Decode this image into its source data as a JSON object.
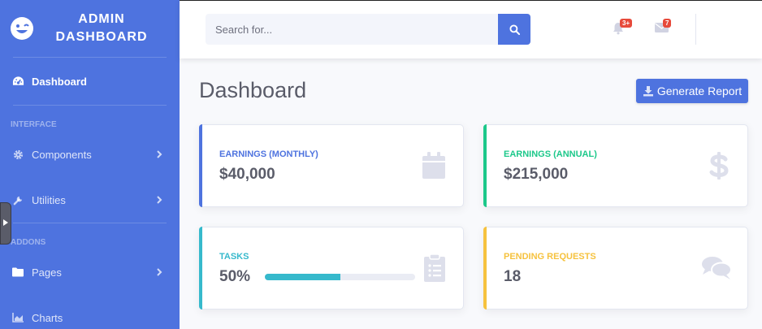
{
  "brand": {
    "title": "ADMIN\nDASHBOARD"
  },
  "sidebar": {
    "active_item": {
      "label": "Dashboard",
      "icon": "tachometer-icon"
    },
    "sections": [
      {
        "heading": "INTERFACE",
        "items": [
          {
            "label": "Components",
            "icon": "gear-icon"
          },
          {
            "label": "Utilities",
            "icon": "wrench-icon"
          }
        ]
      },
      {
        "heading": "ADDONS",
        "items": [
          {
            "label": "Pages",
            "icon": "folder-icon"
          },
          {
            "label": "Charts",
            "icon": "chart-area-icon"
          }
        ]
      }
    ]
  },
  "topbar": {
    "search_placeholder": "Search for...",
    "alerts_badge": "3+",
    "messages_badge": "7"
  },
  "page": {
    "title": "Dashboard",
    "generate_report_label": "Generate Report"
  },
  "cards": [
    {
      "label": "EARNINGS (MONTHLY)",
      "value": "$40,000",
      "color": "#4e73df",
      "icon": "calendar-icon"
    },
    {
      "label": "EARNINGS (ANNUAL)",
      "value": "$215,000",
      "color": "#1cc88a",
      "icon": "dollar-icon"
    },
    {
      "label": "TASKS",
      "value": "50%",
      "progress": 0.5,
      "color": "#36b9cc",
      "icon": "clipboard-list-icon"
    },
    {
      "label": "PENDING REQUESTS",
      "value": "18",
      "color": "#f6c23e",
      "icon": "comments-icon"
    }
  ],
  "colors": {
    "primary": "#4e73df",
    "text": "#5a5c69",
    "icon_muted": "#dddfeb",
    "danger": "#e74a3b"
  }
}
